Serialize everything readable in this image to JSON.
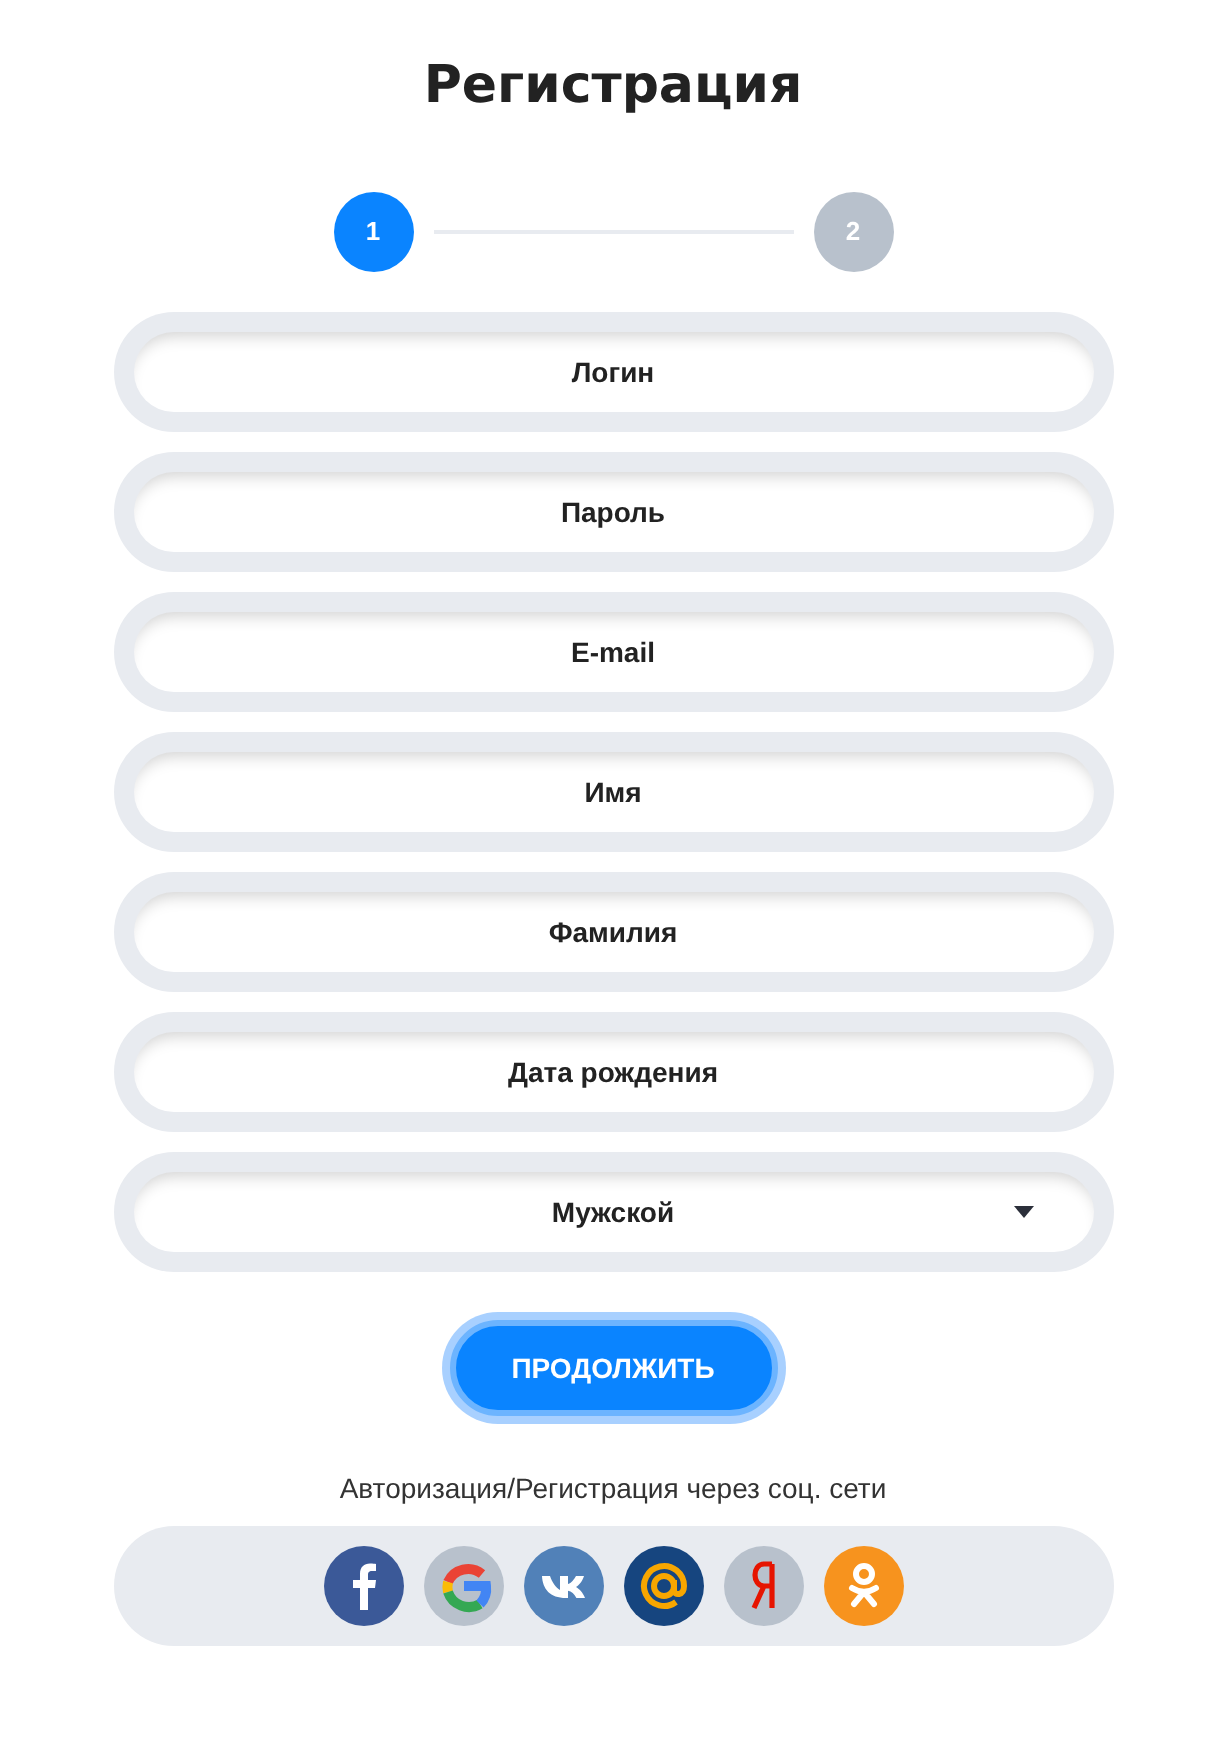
{
  "title": "Регистрация",
  "steps": [
    {
      "label": "1",
      "selected": true
    },
    {
      "label": "2",
      "selected": false
    }
  ],
  "fields": [
    {
      "kind": "text",
      "placeholder": "Логин"
    },
    {
      "kind": "text",
      "placeholder": "Пароль"
    },
    {
      "kind": "text",
      "placeholder": "E-mail"
    },
    {
      "kind": "text",
      "placeholder": "Имя"
    },
    {
      "kind": "text",
      "placeholder": "Фамилия"
    },
    {
      "kind": "text",
      "placeholder": "Дата рождения"
    },
    {
      "kind": "select",
      "value": "Мужской"
    }
  ],
  "continue_button": "ПРОДОЛЖИТЬ",
  "social_caption": "Авторизация/Регистрация через соц. сети",
  "social": [
    {
      "kind": "facebook",
      "color": "#3b5998"
    },
    {
      "kind": "google",
      "color": "#b8c1cc"
    },
    {
      "kind": "vk",
      "color": "#5181b8"
    },
    {
      "kind": "mail",
      "color": "#16457f"
    },
    {
      "kind": "yandex",
      "color": "#b8c1cc"
    },
    {
      "kind": "ok",
      "color": "#f7931e"
    }
  ]
}
